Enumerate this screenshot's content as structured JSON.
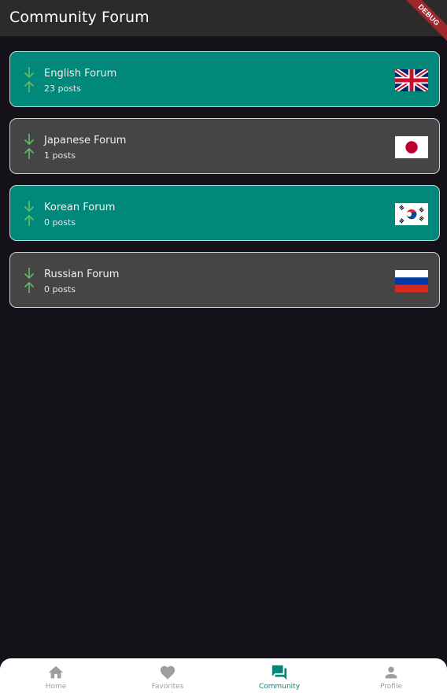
{
  "appbar": {
    "title": "Community Forum",
    "debug_label": "DEBUG"
  },
  "colors": {
    "teal": "#00897b",
    "card_gray": "#454545",
    "arrow_green": "#66bb6a",
    "background": "#141218",
    "nav_inactive": "#9e9e9e"
  },
  "forums": [
    {
      "title": "English Forum",
      "posts": "23 posts",
      "flag_icon": "uk-flag-icon",
      "style": "teal"
    },
    {
      "title": "Japanese Forum",
      "posts": "1 posts",
      "flag_icon": "japan-flag-icon",
      "style": "gray"
    },
    {
      "title": "Korean Forum",
      "posts": "0 posts",
      "flag_icon": "korea-flag-icon",
      "style": "teal"
    },
    {
      "title": "Russian Forum",
      "posts": "0 posts",
      "flag_icon": "russia-flag-icon",
      "style": "gray"
    }
  ],
  "bottom_nav": {
    "items": [
      {
        "label": "Home",
        "icon": "home-icon",
        "active": false
      },
      {
        "label": "Favorites",
        "icon": "heart-icon",
        "active": false
      },
      {
        "label": "Community",
        "icon": "forum-icon",
        "active": true
      },
      {
        "label": "Profile",
        "icon": "person-icon",
        "active": false
      }
    ]
  }
}
